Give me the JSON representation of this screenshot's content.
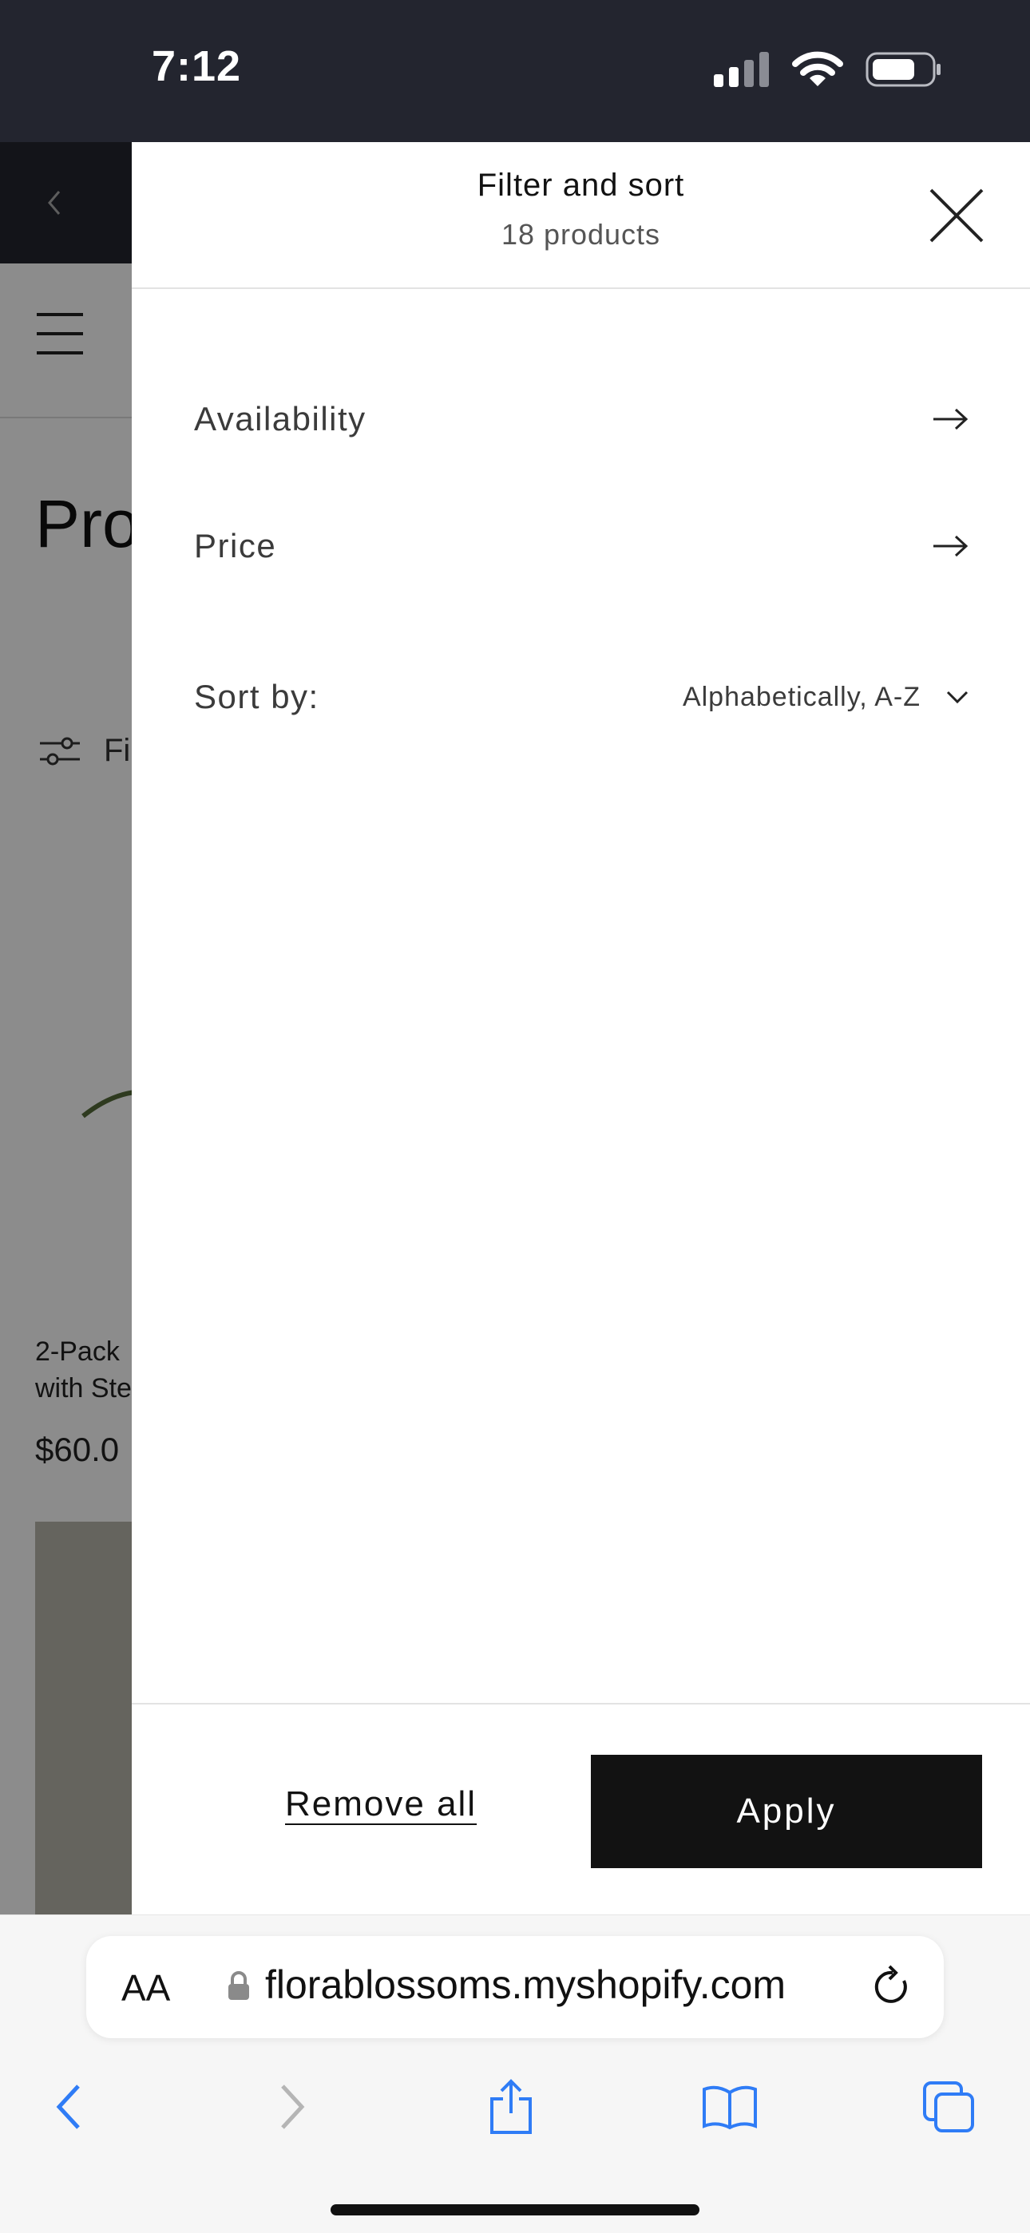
{
  "status_bar": {
    "time": "7:12"
  },
  "background_page": {
    "title_partial": "Pro",
    "filter_partial": "Fi",
    "product_name_partial": "2-Pack\nwith Ste",
    "product_price_partial": "$60.0"
  },
  "drawer": {
    "title": "Filter and sort",
    "product_count": "18 products",
    "filters": [
      {
        "label": "Availability"
      },
      {
        "label": "Price"
      }
    ],
    "sort": {
      "label": "Sort by:",
      "value": "Alphabetically, A-Z"
    },
    "footer": {
      "remove_all": "Remove all",
      "apply": "Apply"
    }
  },
  "browser": {
    "aa_label": "AA",
    "url": "florablossoms.myshopify.com"
  },
  "colors": {
    "accent": "#121212",
    "status_bar": "#23252f",
    "browser_blue": "#2f7cf6"
  }
}
